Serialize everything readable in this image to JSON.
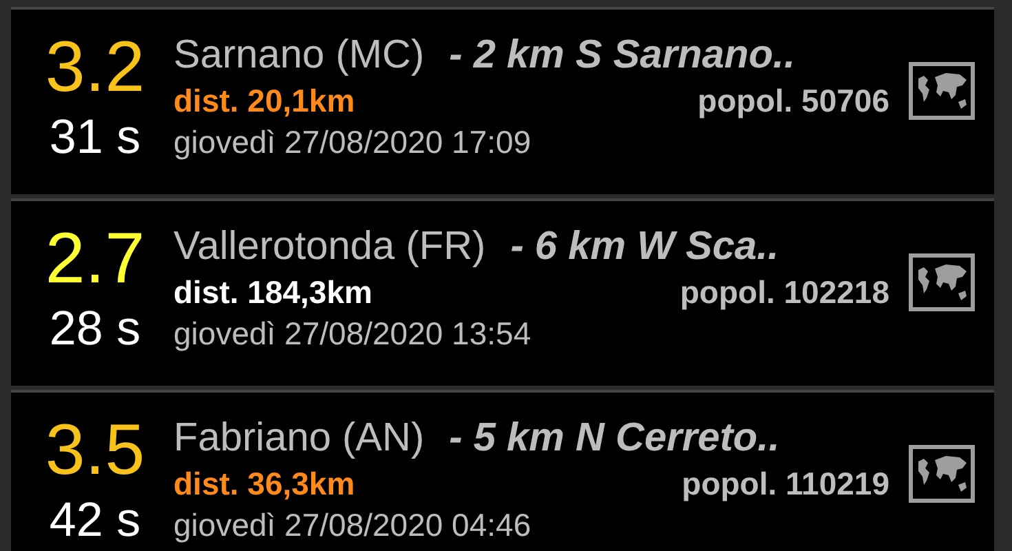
{
  "events": [
    {
      "magnitude": "3.2",
      "color": "#f7c21a",
      "elapsed": "31 s",
      "place": "Sarnano (MC)",
      "description": "- 2 km S Sarnano..",
      "distance": "dist. 20,1km",
      "near": true,
      "population": "popol. 50706",
      "datetime": "giovedì 27/08/2020 17:09"
    },
    {
      "magnitude": "2.7",
      "color": "#ffff33",
      "elapsed": "28 s",
      "place": "Vallerotonda (FR)",
      "description": "- 6 km W Sca..",
      "distance": "dist. 184,3km",
      "near": false,
      "population": "popol. 102218",
      "datetime": "giovedì 27/08/2020 13:54"
    },
    {
      "magnitude": "3.5",
      "color": "#f7c21a",
      "elapsed": "42 s",
      "place": "Fabriano (AN)",
      "description": "- 5 km N Cerreto..",
      "distance": "dist. 36,3km",
      "near": true,
      "population": "popol. 110219",
      "datetime": "giovedì 27/08/2020 04:46"
    }
  ]
}
